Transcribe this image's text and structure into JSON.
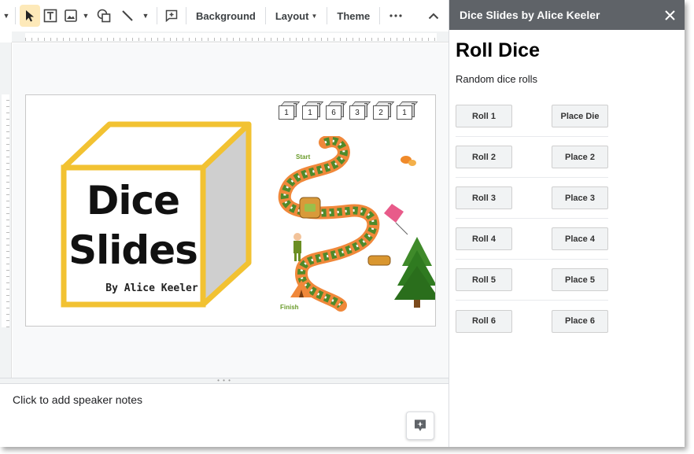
{
  "toolbar": {
    "items": [
      "Background",
      "Layout",
      "Theme"
    ]
  },
  "slide": {
    "title_line1": "Dice",
    "title_line2": "Slides",
    "byline": "By Alice Keeler",
    "dice_values": [
      "1",
      "1",
      "6",
      "3",
      "2",
      "1"
    ],
    "board_start": "Start",
    "board_finish": "Finish"
  },
  "notes": {
    "placeholder": "Click to add speaker notes"
  },
  "sidebar": {
    "header": "Dice Slides by Alice Keeler",
    "title": "Roll Dice",
    "subtitle": "Random dice rolls",
    "rows": [
      {
        "roll": "Roll 1",
        "place": "Place Die"
      },
      {
        "roll": "Roll 2",
        "place": "Place 2"
      },
      {
        "roll": "Roll 3",
        "place": "Place 3"
      },
      {
        "roll": "Roll 4",
        "place": "Place 4"
      },
      {
        "roll": "Roll 5",
        "place": "Place 5"
      },
      {
        "roll": "Roll 6",
        "place": "Place 6"
      }
    ]
  },
  "colors": {
    "sidebar_header": "#5f6368",
    "cube_frame": "#f2c232",
    "board_orange": "#f0883a",
    "board_green": "#4f8a2b",
    "active_tool": "#fde9b9"
  },
  "icons": [
    "chevron-down-icon",
    "select-cursor-icon",
    "text-box-icon",
    "image-icon",
    "shape-icon",
    "line-icon",
    "add-comment-icon",
    "more-icon",
    "chevron-up-icon",
    "close-icon",
    "explore-icon"
  ]
}
